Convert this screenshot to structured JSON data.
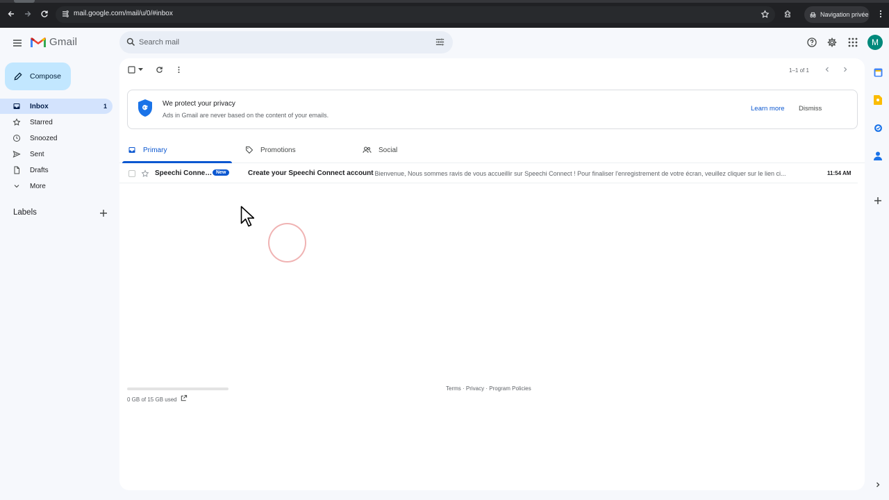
{
  "browser": {
    "url": "mail.google.com/mail/u/0/#inbox",
    "incognito_label": "Navigation privée"
  },
  "header": {
    "app_name": "Gmail",
    "search_placeholder": "Search mail",
    "avatar_letter": "M"
  },
  "sidebar": {
    "compose_label": "Compose",
    "items": [
      {
        "label": "Inbox",
        "count": "1",
        "icon": "inbox-icon",
        "active": true
      },
      {
        "label": "Starred",
        "icon": "star-icon"
      },
      {
        "label": "Snoozed",
        "icon": "clock-icon"
      },
      {
        "label": "Sent",
        "icon": "send-icon"
      },
      {
        "label": "Drafts",
        "icon": "draft-icon"
      },
      {
        "label": "More",
        "icon": "chevron-down-icon"
      }
    ],
    "labels_title": "Labels"
  },
  "toolbar": {
    "pager": "1–1 of 1"
  },
  "privacy_card": {
    "title": "We protect your privacy",
    "subtitle": "Ads in Gmail are never based on the content of your emails.",
    "learn_more": "Learn more",
    "dismiss": "Dismiss"
  },
  "tabs": [
    {
      "label": "Primary",
      "active": true
    },
    {
      "label": "Promotions"
    },
    {
      "label": "Social"
    }
  ],
  "emails": [
    {
      "sender": "Speechi Conne…",
      "badge": "New",
      "subject": "Create your Speechi Connect account",
      "snippet": " - Bienvenue, Nous sommes ravis de vous accueillir sur Speechi Connect ! Pour finaliser l'enregistrement de votre écran, veuillez cliquer sur le lien ci...",
      "time": "11:54 AM"
    }
  ],
  "footer": {
    "storage": "0 GB of 15 GB used",
    "links": "Terms · Privacy · Program Policies"
  },
  "colors": {
    "accent": "#0b57d0",
    "compose_bg": "#c2e7ff",
    "active_nav_bg": "#d3e3fd",
    "avatar_bg": "#00897b"
  }
}
